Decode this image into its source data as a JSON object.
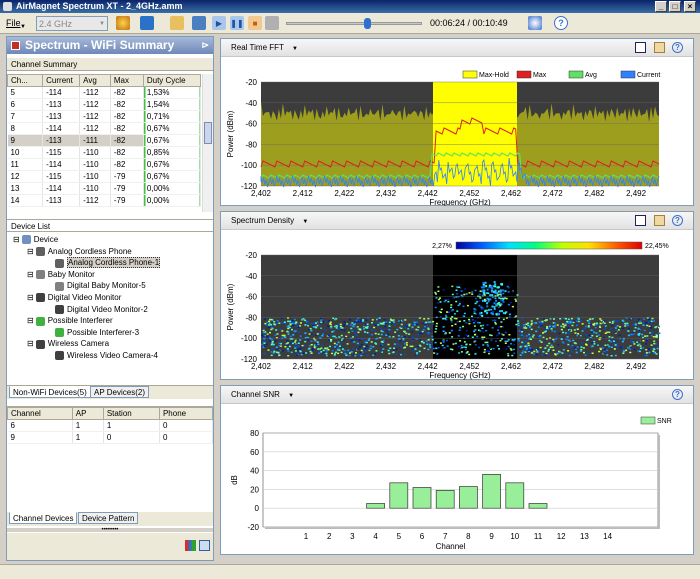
{
  "window": {
    "title": "AirMagnet Spectrum XT  -  2_4GHz.amm",
    "minimize": "_",
    "maximize": "□",
    "close": "×"
  },
  "toolbar": {
    "file_menu": "File",
    "band_select": "2.4 GHz",
    "time": "00:06:24 / 00:10:49",
    "playback_progress": 0.59
  },
  "left_panel": {
    "title": "Spectrum - WiFi Summary",
    "channel_summary": {
      "title": "Channel Summary",
      "columns": [
        "Ch...",
        "Current",
        "Avg",
        "Max",
        "Duty Cycle"
      ],
      "rows": [
        [
          "5",
          "-114",
          "-112",
          "-82",
          "1,53%"
        ],
        [
          "6",
          "-113",
          "-112",
          "-82",
          "1,54%"
        ],
        [
          "7",
          "-113",
          "-112",
          "-82",
          "0,71%"
        ],
        [
          "8",
          "-114",
          "-112",
          "-82",
          "0,67%"
        ],
        [
          "9",
          "-113",
          "-111",
          "-82",
          "0,67%"
        ],
        [
          "10",
          "-115",
          "-110",
          "-82",
          "0,85%"
        ],
        [
          "11",
          "-114",
          "-110",
          "-82",
          "0,67%"
        ],
        [
          "12",
          "-115",
          "-110",
          "-79",
          "0,67%"
        ],
        [
          "13",
          "-114",
          "-110",
          "-79",
          "0,00%"
        ],
        [
          "14",
          "-113",
          "-112",
          "-79",
          "0,00%"
        ]
      ],
      "selected_index": 4
    },
    "device_list": {
      "title": "Device List",
      "items": [
        {
          "label": "Device",
          "level": 0,
          "icon": "device-root-icon"
        },
        {
          "label": "Analog Cordless Phone",
          "level": 1,
          "icon": "cordless-phone-icon"
        },
        {
          "label": "Analog Cordless Phone-1",
          "level": 2,
          "icon": "cordless-phone-icon",
          "selected": true
        },
        {
          "label": "Baby Monitor",
          "level": 1,
          "icon": "baby-monitor-icon"
        },
        {
          "label": "Digital Baby Monitor-5",
          "level": 2,
          "icon": "baby-monitor-icon"
        },
        {
          "label": "Digital Video Monitor",
          "level": 1,
          "icon": "camera-icon"
        },
        {
          "label": "Digital Video Monitor-2",
          "level": 2,
          "icon": "camera-icon"
        },
        {
          "label": "Possible Interferer",
          "level": 1,
          "icon": "interferer-icon"
        },
        {
          "label": "Possible Interferer-3",
          "level": 2,
          "icon": "interferer-icon"
        },
        {
          "label": "Wireless Camera",
          "level": 1,
          "icon": "camera-icon"
        },
        {
          "label": "Wireless Video Camera-4",
          "level": 2,
          "icon": "camera-icon"
        }
      ],
      "tabs": [
        "Non-WiFi Devices(5)",
        "AP Devices(2)"
      ]
    },
    "channel_devices": {
      "columns": [
        "Channel",
        "AP",
        "Station",
        "Phone"
      ],
      "rows": [
        [
          "6",
          "1",
          "1",
          "0"
        ],
        [
          "9",
          "1",
          "0",
          "0"
        ]
      ],
      "tabs": [
        "Channel Devices",
        "Device Pattern"
      ]
    }
  },
  "fft": {
    "title": "Real Time FFT",
    "legend": [
      "Max-Hold",
      "Max",
      "Avg",
      "Current"
    ],
    "colors": {
      "maxhold": "#ffff00",
      "max": "#e02020",
      "avg": "#60e060",
      "current": "#3080ff",
      "plotbg": "#3c3c3c",
      "band": "#9e9e1e"
    },
    "ylabel": "Power (dBm)",
    "xlabel": "Frequency (GHz)",
    "yticks": [
      "-20",
      "-40",
      "-60",
      "-80",
      "-100",
      "-120"
    ],
    "xticks": [
      "2,402",
      "2,412",
      "2,422",
      "2,432",
      "2,442",
      "2,452",
      "2,462",
      "2,472",
      "2,482",
      "2,492"
    ]
  },
  "density": {
    "title": "Spectrum Density",
    "scale_min": "2,27%",
    "scale_max": "22,45%",
    "ylabel": "Power (dBm)",
    "xlabel": "Frequency (GHz)",
    "yticks": [
      "-20",
      "-40",
      "-60",
      "-80",
      "-100",
      "-120"
    ],
    "xticks": [
      "2,402",
      "2,412",
      "2,422",
      "2,432",
      "2,442",
      "2,452",
      "2,462",
      "2,472",
      "2,482",
      "2,492"
    ]
  },
  "snr": {
    "title": "Channel SNR",
    "chart_data": {
      "type": "bar",
      "categories": [
        "1",
        "2",
        "3",
        "4",
        "5",
        "6",
        "7",
        "8",
        "9",
        "10",
        "11",
        "12",
        "13",
        "14"
      ],
      "series": [
        {
          "name": "SNR",
          "values": [
            0,
            0,
            0,
            5,
            27,
            22,
            19,
            23,
            36,
            27,
            5,
            0,
            0,
            0
          ]
        }
      ],
      "ylabel": "dB",
      "xlabel": "Channel",
      "ylim": [
        -20,
        80
      ],
      "yticks": [
        "80",
        "60",
        "40",
        "20",
        "0",
        "-20"
      ],
      "bar_color": "#99ee99",
      "legend": "top-right"
    }
  }
}
